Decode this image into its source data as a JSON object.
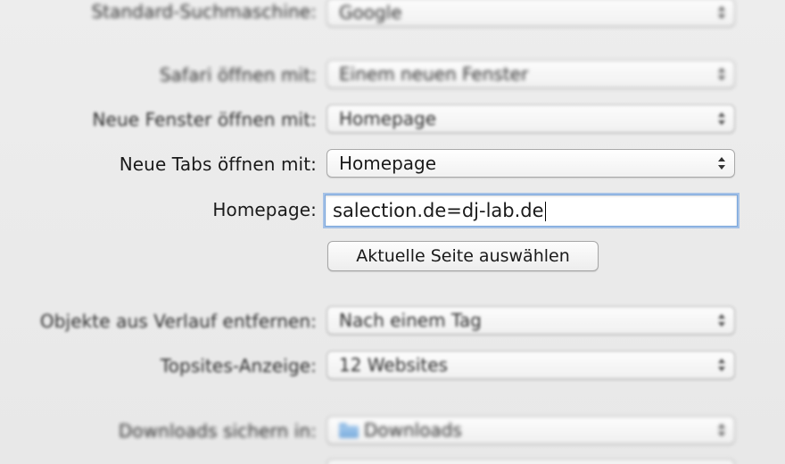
{
  "rows": {
    "search_engine": {
      "label": "Standard-Suchmaschine:",
      "value": "Google"
    },
    "safari_open_with": {
      "label": "Safari öffnen mit:",
      "value": "Einem neuen Fenster"
    },
    "new_windows_open_with": {
      "label": "Neue Fenster öffnen mit:",
      "value": "Homepage"
    },
    "new_tabs_open_with": {
      "label": "Neue Tabs öffnen mit:",
      "value": "Homepage"
    },
    "homepage": {
      "label": "Homepage:",
      "value": "salection.de=dj-lab.de"
    },
    "set_current_page": {
      "label": "Aktuelle Seite auswählen"
    },
    "remove_history": {
      "label": "Objekte aus Verlauf entfernen:",
      "value": "Nach einem Tag"
    },
    "topsites": {
      "label": "Topsites-Anzeige:",
      "value": "12 Websites"
    },
    "downloads_location": {
      "label": "Downloads sichern in:",
      "value": "Downloads",
      "icon": "folder-icon"
    }
  }
}
